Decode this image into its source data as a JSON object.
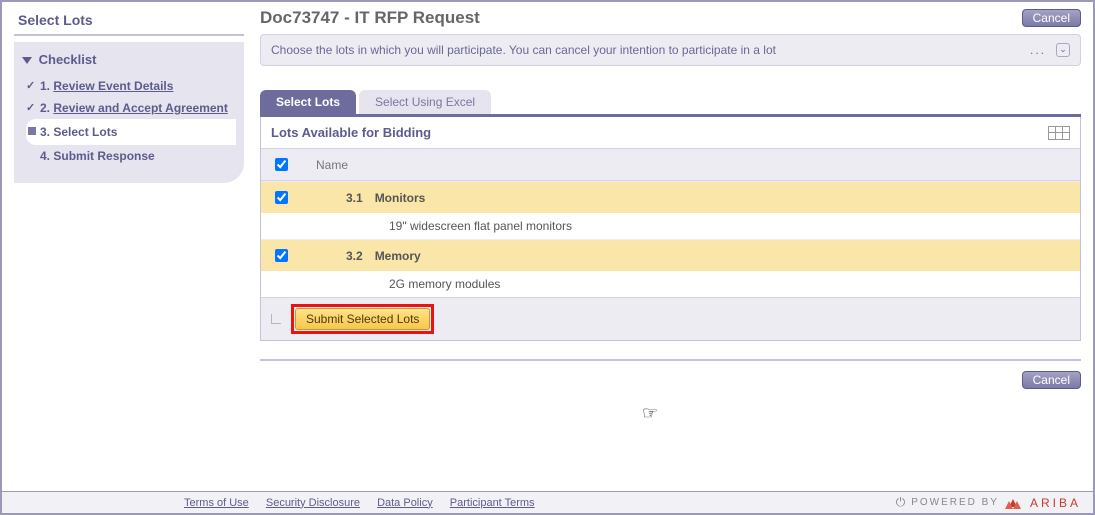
{
  "sidebar": {
    "title": "Select Lots",
    "checklist_label": "Checklist",
    "items": [
      {
        "num": "1.",
        "label": "Review Event Details",
        "done": true,
        "link": true
      },
      {
        "num": "2.",
        "label": "Review and Accept Agreement",
        "done": true,
        "link": true
      },
      {
        "num": "3.",
        "label": "Select Lots",
        "active": true
      },
      {
        "num": "4.",
        "label": "Submit Response"
      }
    ]
  },
  "header": {
    "title": "Doc73747 - IT RFP Request",
    "cancel": "Cancel"
  },
  "instruction": {
    "text": "Choose the lots in which you will participate.  You can cancel your intention to participate in a lot",
    "more": "..."
  },
  "tabs": {
    "active": "Select Lots",
    "inactive": "Select Using Excel"
  },
  "panel": {
    "title": "Lots Available for Bidding",
    "col_name": "Name",
    "lots": [
      {
        "num": "3.1",
        "name": "Monitors",
        "desc": "19\" widescreen flat panel monitors",
        "checked": true
      },
      {
        "num": "3.2",
        "name": "Memory",
        "desc": "2G memory modules",
        "checked": true
      }
    ],
    "submit": "Submit Selected Lots"
  },
  "footer": {
    "links": [
      "Terms of Use",
      "Security Disclosure",
      "Data Policy",
      "Participant Terms"
    ],
    "powered": "POWERED BY",
    "brand": "ARIBA"
  }
}
